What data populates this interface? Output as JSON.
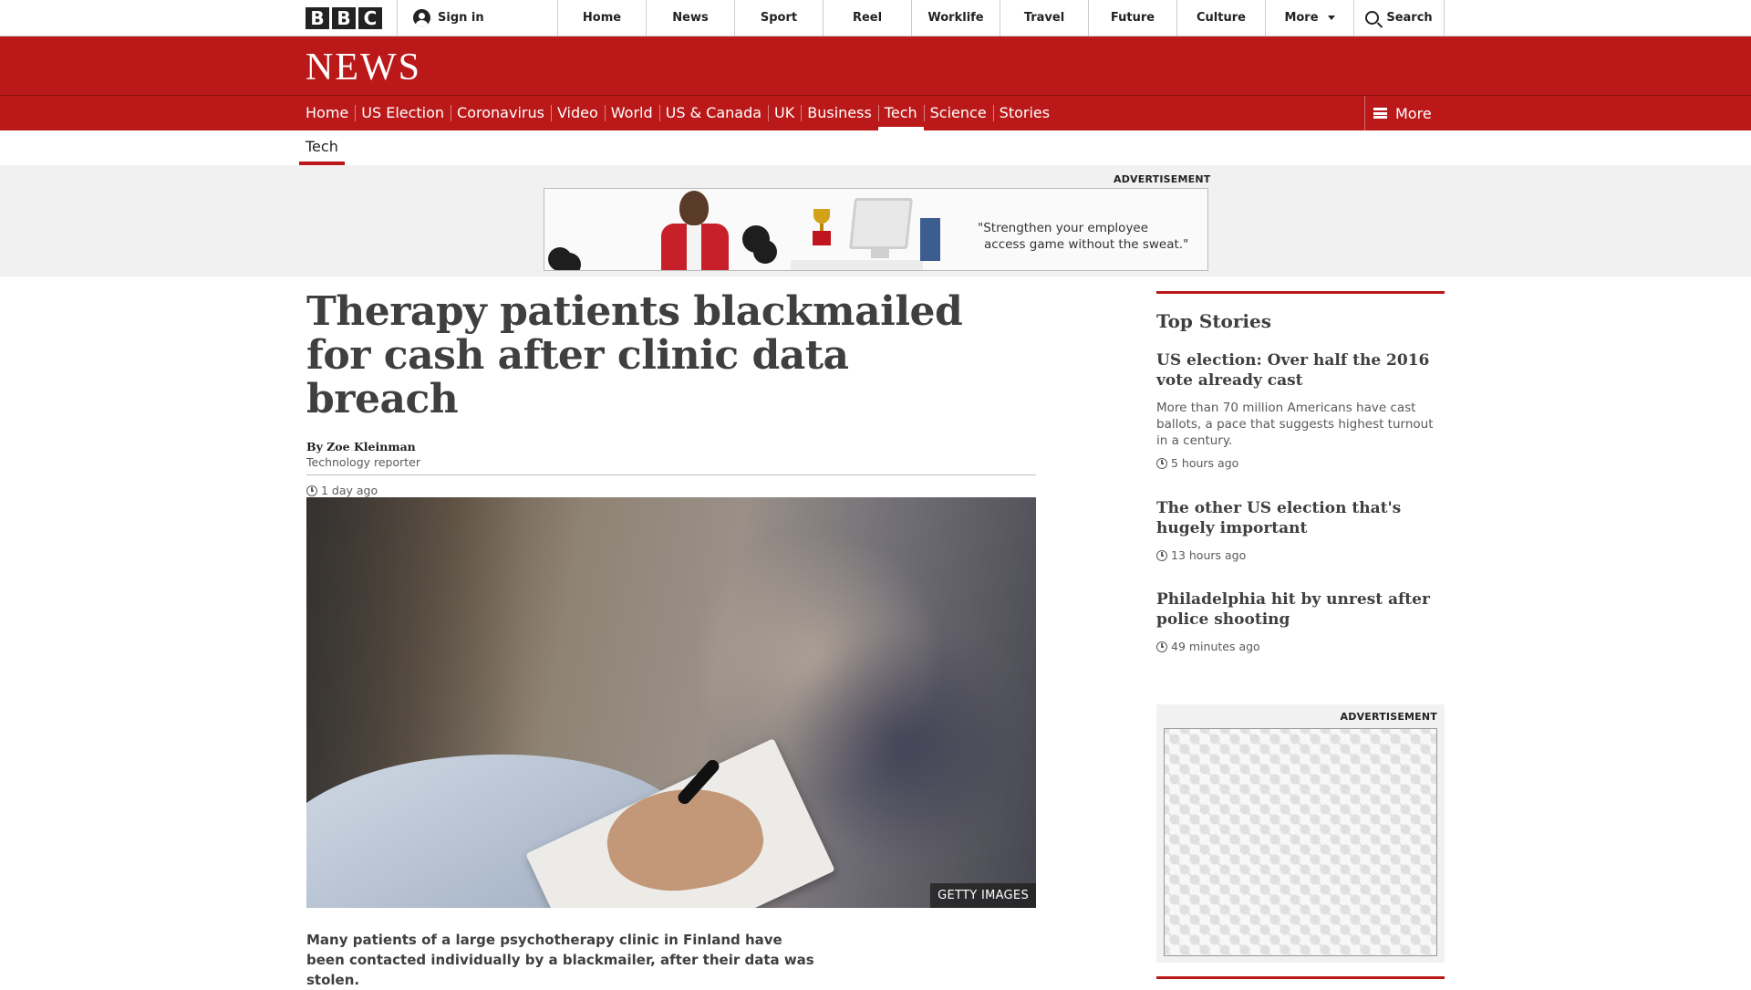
{
  "brand": {
    "bbc_letters": [
      "B",
      "B",
      "C"
    ],
    "news_logo": "NEWS",
    "primary_color": "#bb1919"
  },
  "topbar": {
    "signin": "Sign in",
    "nav": [
      "Home",
      "News",
      "Sport",
      "Reel",
      "Worklife",
      "Travel",
      "Future",
      "Culture",
      "More"
    ],
    "search": "Search"
  },
  "subnav": {
    "items": [
      "Home",
      "US Election",
      "Coronavirus",
      "Video",
      "World",
      "US & Canada",
      "UK",
      "Business",
      "Tech",
      "Science",
      "Stories"
    ],
    "active": "Tech",
    "more": "More"
  },
  "section": {
    "current": "Tech"
  },
  "top_ad": {
    "label": "ADVERTISEMENT",
    "quote_line1": "\"Strengthen your employee",
    "quote_line2": "access game without the sweat.\""
  },
  "article": {
    "headline": "Therapy patients blackmailed for cash after clinic data breach",
    "author": "By Zoe Kleinman",
    "role": "Technology reporter",
    "time": "1 day ago",
    "image_credit": "GETTY IMAGES",
    "lede": "Many patients of a large psychotherapy clinic in Finland have been contacted individually by a blackmailer, after their data was stolen."
  },
  "sidebar": {
    "heading": "Top Stories",
    "stories": [
      {
        "title": "US election: Over half the 2016 vote already cast",
        "summary": "More than 70 million Americans have cast ballots, a pace that suggests highest turnout in a century.",
        "time": "5 hours ago"
      },
      {
        "title": "The other US election that's hugely important",
        "time": "13 hours ago"
      },
      {
        "title": "Philadelphia hit by unrest after police shooting",
        "time": "49 minutes ago"
      }
    ],
    "ad_label": "ADVERTISEMENT"
  }
}
